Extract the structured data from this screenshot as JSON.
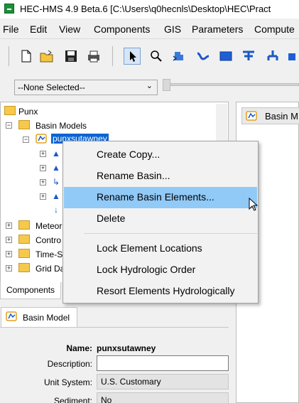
{
  "app": {
    "title": "HEC-HMS 4.9 Beta.6 [C:\\Users\\q0hecnls\\Desktop\\HEC\\Pract"
  },
  "menubar": {
    "items": [
      "File",
      "Edit",
      "View",
      "Components",
      "GIS",
      "Parameters",
      "Compute"
    ]
  },
  "toolbar": {
    "tools": [
      "new-file-icon",
      "open-folder-icon",
      "save-icon",
      "print-icon",
      "arrow-select-icon",
      "zoom-icon",
      "subbasin-tool-icon",
      "reach-tool-icon",
      "reservoir-tool-icon",
      "junction-tool-icon",
      "diversion-tool-icon",
      "sink-tool-icon"
    ]
  },
  "selector": {
    "value": "--None Selected--"
  },
  "tree": {
    "root": "Punx",
    "basin_models": "Basin Models",
    "basin": "punxsutawney",
    "folders": [
      "Meteor",
      "Contro",
      "Time-S",
      "Grid Da"
    ]
  },
  "bottom_tabs": {
    "components": "Components"
  },
  "right_panel": {
    "header": "Basin M"
  },
  "context_menu": {
    "items": [
      "Create Copy...",
      "Rename Basin...",
      "Rename Basin Elements...",
      "Delete",
      "Lock Element Locations",
      "Lock Hydrologic Order",
      "Resort Elements Hydrologically"
    ],
    "highlighted": "Rename Basin Elements..."
  },
  "properties": {
    "tab": "Basin Model",
    "name_label": "Name:",
    "name_value": "punxsutawney",
    "description_label": "Description:",
    "description_value": "",
    "unit_label": "Unit System:",
    "unit_value": "U.S. Customary",
    "sediment_label": "Sediment:",
    "sediment_value": "No"
  },
  "colors": {
    "selection": "#0a64d2",
    "menu_highlight": "#91c9f7",
    "folder": "#f7c94a"
  }
}
